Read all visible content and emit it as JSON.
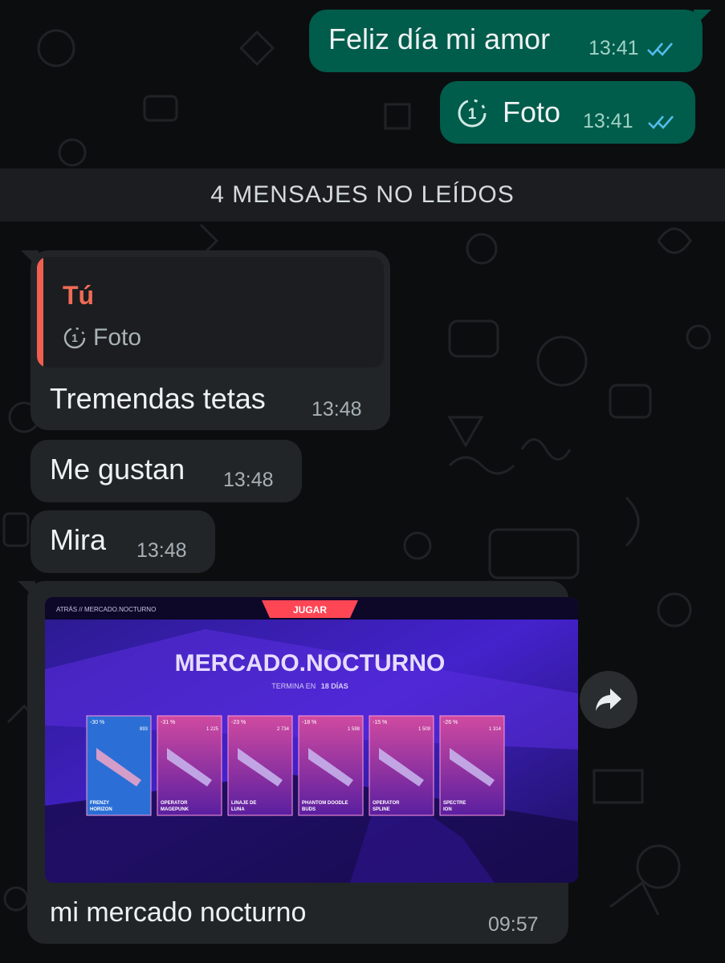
{
  "messages_out": [
    {
      "text": "Feliz día mi amor",
      "time": "13:41",
      "status": "read"
    },
    {
      "text": "Foto",
      "time": "13:41",
      "status": "read",
      "icon": "view-once-icon",
      "view_once_label": "1"
    }
  ],
  "unread_divider": "4 MENSAJES NO LEÍDOS",
  "messages_in": [
    {
      "quote_author": "Tú",
      "quote_text": "Foto",
      "quote_icon": "view-once-icon",
      "quote_icon_label": "1",
      "text": "Tremendas tetas",
      "time": "13:48"
    },
    {
      "text": "Me gustan",
      "time": "13:48"
    },
    {
      "text": "Mira",
      "time": "13:48"
    }
  ],
  "image_message": {
    "caption": "mi mercado nocturno",
    "time": "09:57",
    "photo": {
      "nav_back": "ATRÁS // MERCADO.NOCTURNO",
      "play_button": "JUGAR",
      "title": "MERCADO.NOCTURNO",
      "subtitle_prefix": "TERMINA EN",
      "subtitle_days": "18 DÍAS",
      "cards": [
        {
          "name": "FRENZY HORIZON",
          "discount": "-30 %",
          "price": "893"
        },
        {
          "name": "OPERATOR MAGEPUNK",
          "discount": "-31 %",
          "price": "1 225"
        },
        {
          "name": "LINAJE DE LUNA",
          "discount": "-23 %",
          "price": "2 734"
        },
        {
          "name": "PHANTOM DOODLE BUDS",
          "discount": "-18 %",
          "price": "1 598"
        },
        {
          "name": "OPERATOR SPLINE",
          "discount": "-15 %",
          "price": "1 509"
        },
        {
          "name": "SPECTRE ION",
          "discount": "-26 %",
          "price": "1 314"
        }
      ]
    }
  },
  "forward_button_icon": "forward-icon",
  "colors": {
    "outgoing_bubble": "#005c4b",
    "incoming_bubble": "#222528",
    "quote_accent": "#f05f4f",
    "read_ticks": "#53bdeb",
    "valorant_red": "#ff4655"
  }
}
